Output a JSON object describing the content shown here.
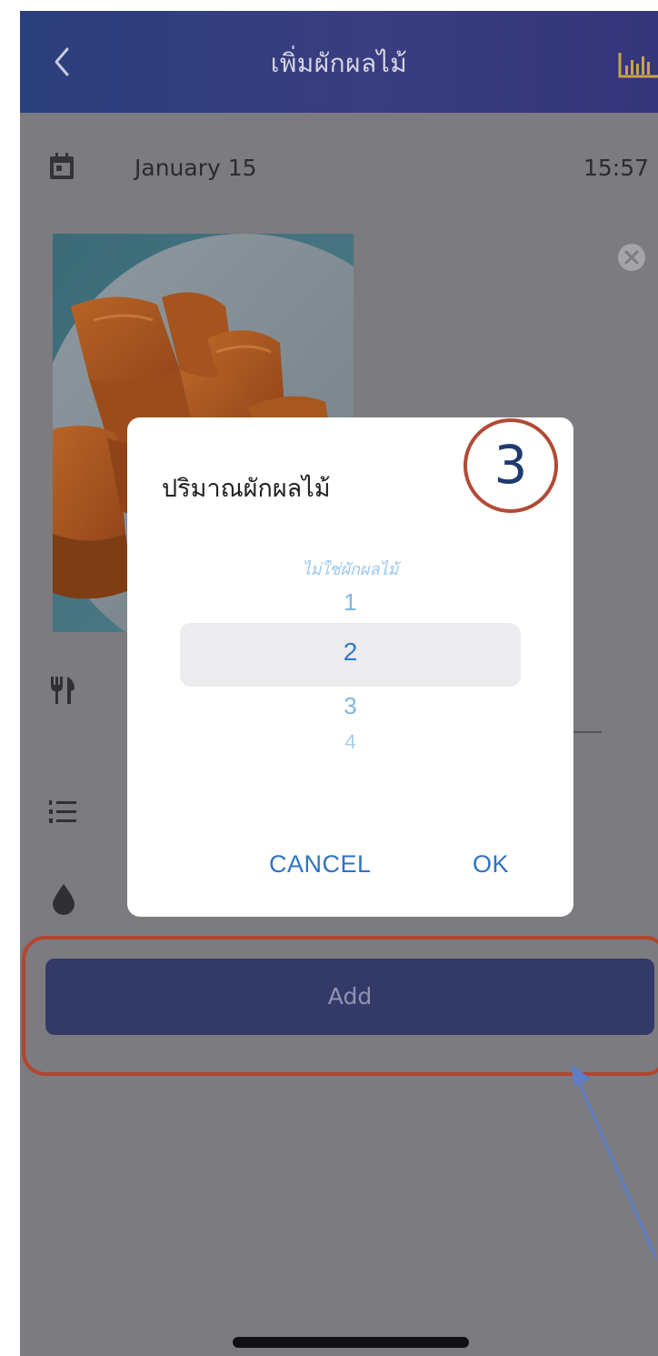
{
  "header": {
    "title": "เพิ่มผักผลไม้"
  },
  "entry": {
    "date": "January 15",
    "time": "15:57"
  },
  "photo": {
    "alt": "ผักผลไม้"
  },
  "dialog": {
    "title": "ปริมาณผักผลไม้",
    "options": [
      "ไม่ใช่ผักผลไม้",
      "1",
      "2",
      "3",
      "4"
    ],
    "selected": "2",
    "cancel_label": "CANCEL",
    "ok_label": "OK"
  },
  "annotation": {
    "step_number": "3"
  },
  "add_button": {
    "label": "Add"
  },
  "icons": {
    "back": "chevron-left-icon",
    "stats": "bar-chart-icon",
    "calendar": "calendar-icon",
    "close": "close-circle-icon",
    "fork_knife": "fork-knife-icon",
    "list": "numbered-list-icon",
    "drop": "water-drop-icon"
  },
  "colors": {
    "header_bg": "#3a3d80",
    "button_bg": "#333a68",
    "dialog_button_text": "#2f73c3",
    "picker_selected": "#2f79c8",
    "annotation_red": "#b2452e",
    "annotation_arrow": "#5c7fc7"
  }
}
